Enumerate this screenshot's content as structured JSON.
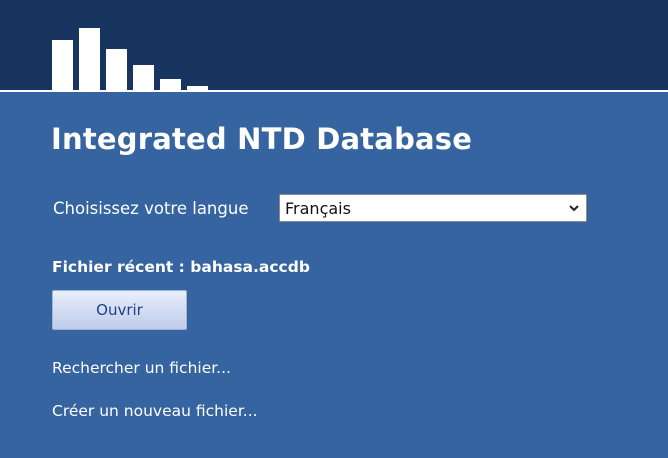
{
  "app": {
    "title": "Integrated NTD Database"
  },
  "language": {
    "label": "Choisissez votre langue",
    "selected": "Français"
  },
  "recent_file": {
    "label": "Fichier récent : bahasa.accdb",
    "open_label": "Ouvrir"
  },
  "links": {
    "browse": "Rechercher un fichier...",
    "new_file": "Créer un nouveau fichier..."
  },
  "colors": {
    "header_bg": "#17355f",
    "main_bg": "#3564a0",
    "text": "#ffffff",
    "button_text": "#1f3f86"
  },
  "icons": {
    "logo": "bar-chart-logo-icon",
    "select_arrow": "chevron-down-icon"
  }
}
